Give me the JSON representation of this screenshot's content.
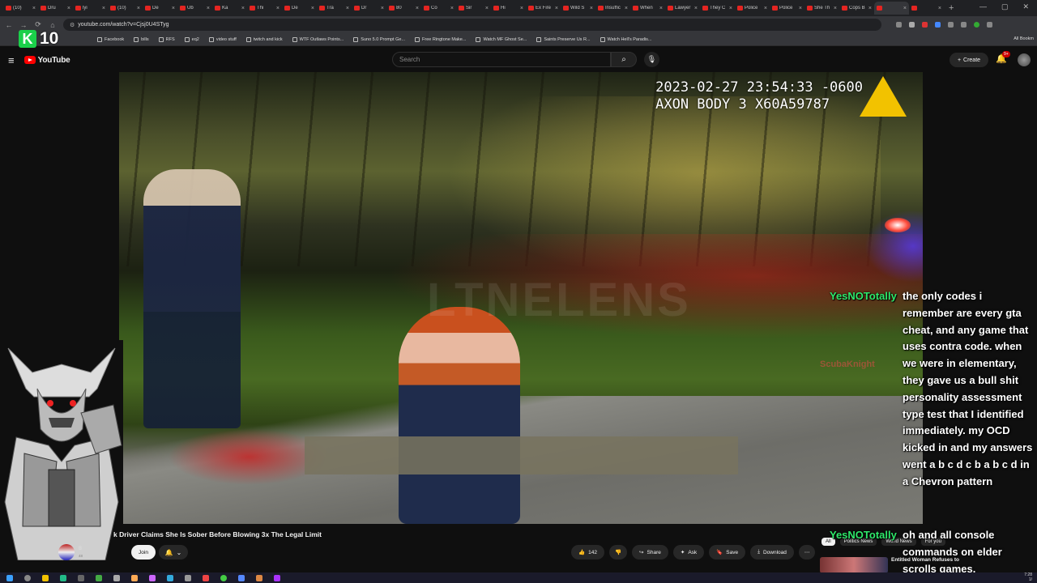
{
  "browser": {
    "tabs": [
      "(10)",
      "Dru",
      "lyi",
      "(10)",
      "De",
      "Ub",
      "Ka",
      "Thi",
      "De",
      "Tra",
      "Dr",
      "80",
      "Co",
      "Sir",
      "Hi",
      "Ex Fire",
      "Wild S",
      "Insuffic",
      "When",
      "Lawyer",
      "They C",
      "Police",
      "Police",
      "She Th",
      "Cops B",
      "",
      ""
    ],
    "active_tab_index": 25,
    "url": "youtube.com/watch?v=Cjsj0U4STyg",
    "new_tab_symbol": "+",
    "window_controls": [
      "—",
      "▢",
      "✕"
    ]
  },
  "bookmarks": {
    "items": [
      "Facebook",
      "bills",
      "RFS",
      "eq2",
      "video stuff",
      "twitch and kick",
      "WTF Outlaws Points...",
      "Suno 5.0 Prompt Ge...",
      "Free Ringtone Make...",
      "Watch MF Ghost Se...",
      "Saints Preserve Us R...",
      "Watch Hell's Paradis..."
    ],
    "all_label": "All Bookm"
  },
  "overlay_logo": {
    "letter": "K",
    "number": "10"
  },
  "youtube": {
    "logo_text": "YouTube",
    "search_placeholder": "Search",
    "create_label": "Create",
    "notification_count": "9+"
  },
  "video": {
    "timestamp_line1": "2023-02-27 23:54:33 -0600",
    "timestamp_line2": "AXON BODY 3 X60A59787",
    "watermark": "LTNELENS",
    "title": "k Driver Claims She Is Sober Before Blowing 3x The Legal Limit",
    "channel_name": "B",
    "channel_subs": "48",
    "join_label": "Join",
    "like_count": "142",
    "share_label": "Share",
    "ask_label": "Ask",
    "save_label": "Save",
    "download_label": "Download"
  },
  "chips": [
    "All",
    "Politics News",
    "World News",
    "For you"
  ],
  "recommendation": {
    "title": "Entitled Woman Refuses to"
  },
  "chat": {
    "message1": {
      "user": "YesNOTotally",
      "text": "the only codes i remember are every gta cheat, and any game that uses contra code. when we were in elementary, they gave us a bull shit personality assessment type test that I identified immediately. my OCD kicked in and my answers went a b c d c b a b c d in a Chevron pattern"
    },
    "faded_user": "ScubaKnight",
    "message2": {
      "user": "YesNOTotally",
      "text": "oh and all console commands on elder scrolls games."
    }
  },
  "taskbar": {
    "time": "7:28",
    "date": "1/"
  }
}
